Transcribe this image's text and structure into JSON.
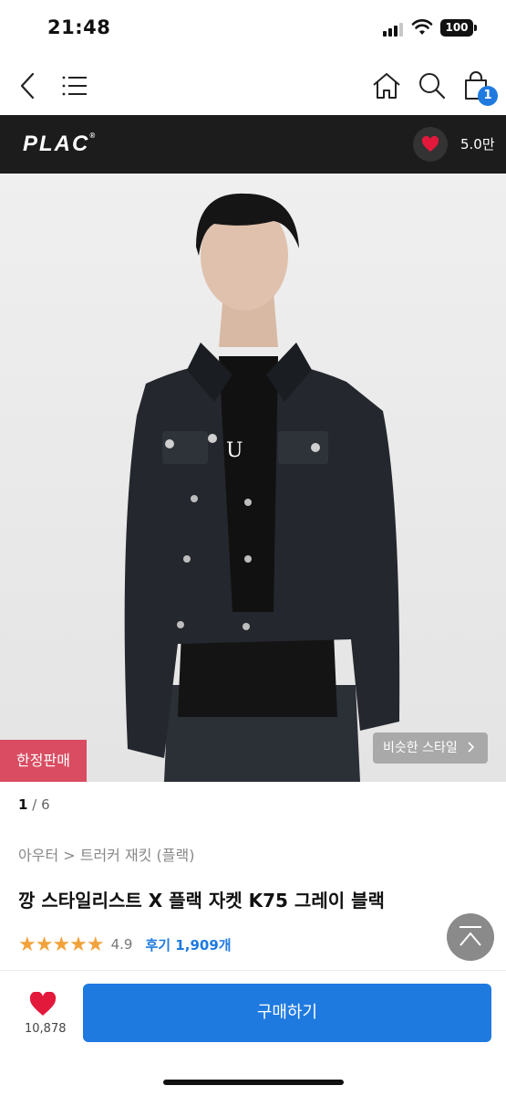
{
  "status_bar": {
    "time": "21:48",
    "battery": "100"
  },
  "nav": {
    "cart_count": "1"
  },
  "brand": {
    "name": "PLAC",
    "trademark": "®",
    "likes": "5.0만"
  },
  "image": {
    "limited_badge": "한정판매",
    "similar_style": "비슷한 스타일",
    "shirt_print": "U"
  },
  "gallery": {
    "current": "1",
    "separator": "/",
    "total": "6"
  },
  "product": {
    "breadcrumb": "아우터 > 트러커 재킷 (플랙)",
    "title": "깡 스타일리스트 X 플랙 자켓 K75 그레이 블랙",
    "stars": "★★★★★",
    "rating": "4.9",
    "reviews": "후기 1,909개"
  },
  "bottom": {
    "wish_count": "10,878",
    "buy_label": "구매하기"
  },
  "colors": {
    "accent": "#1f7ae0",
    "badge": "#d94c61",
    "star": "#f2a23c",
    "like": "#e3193c"
  }
}
